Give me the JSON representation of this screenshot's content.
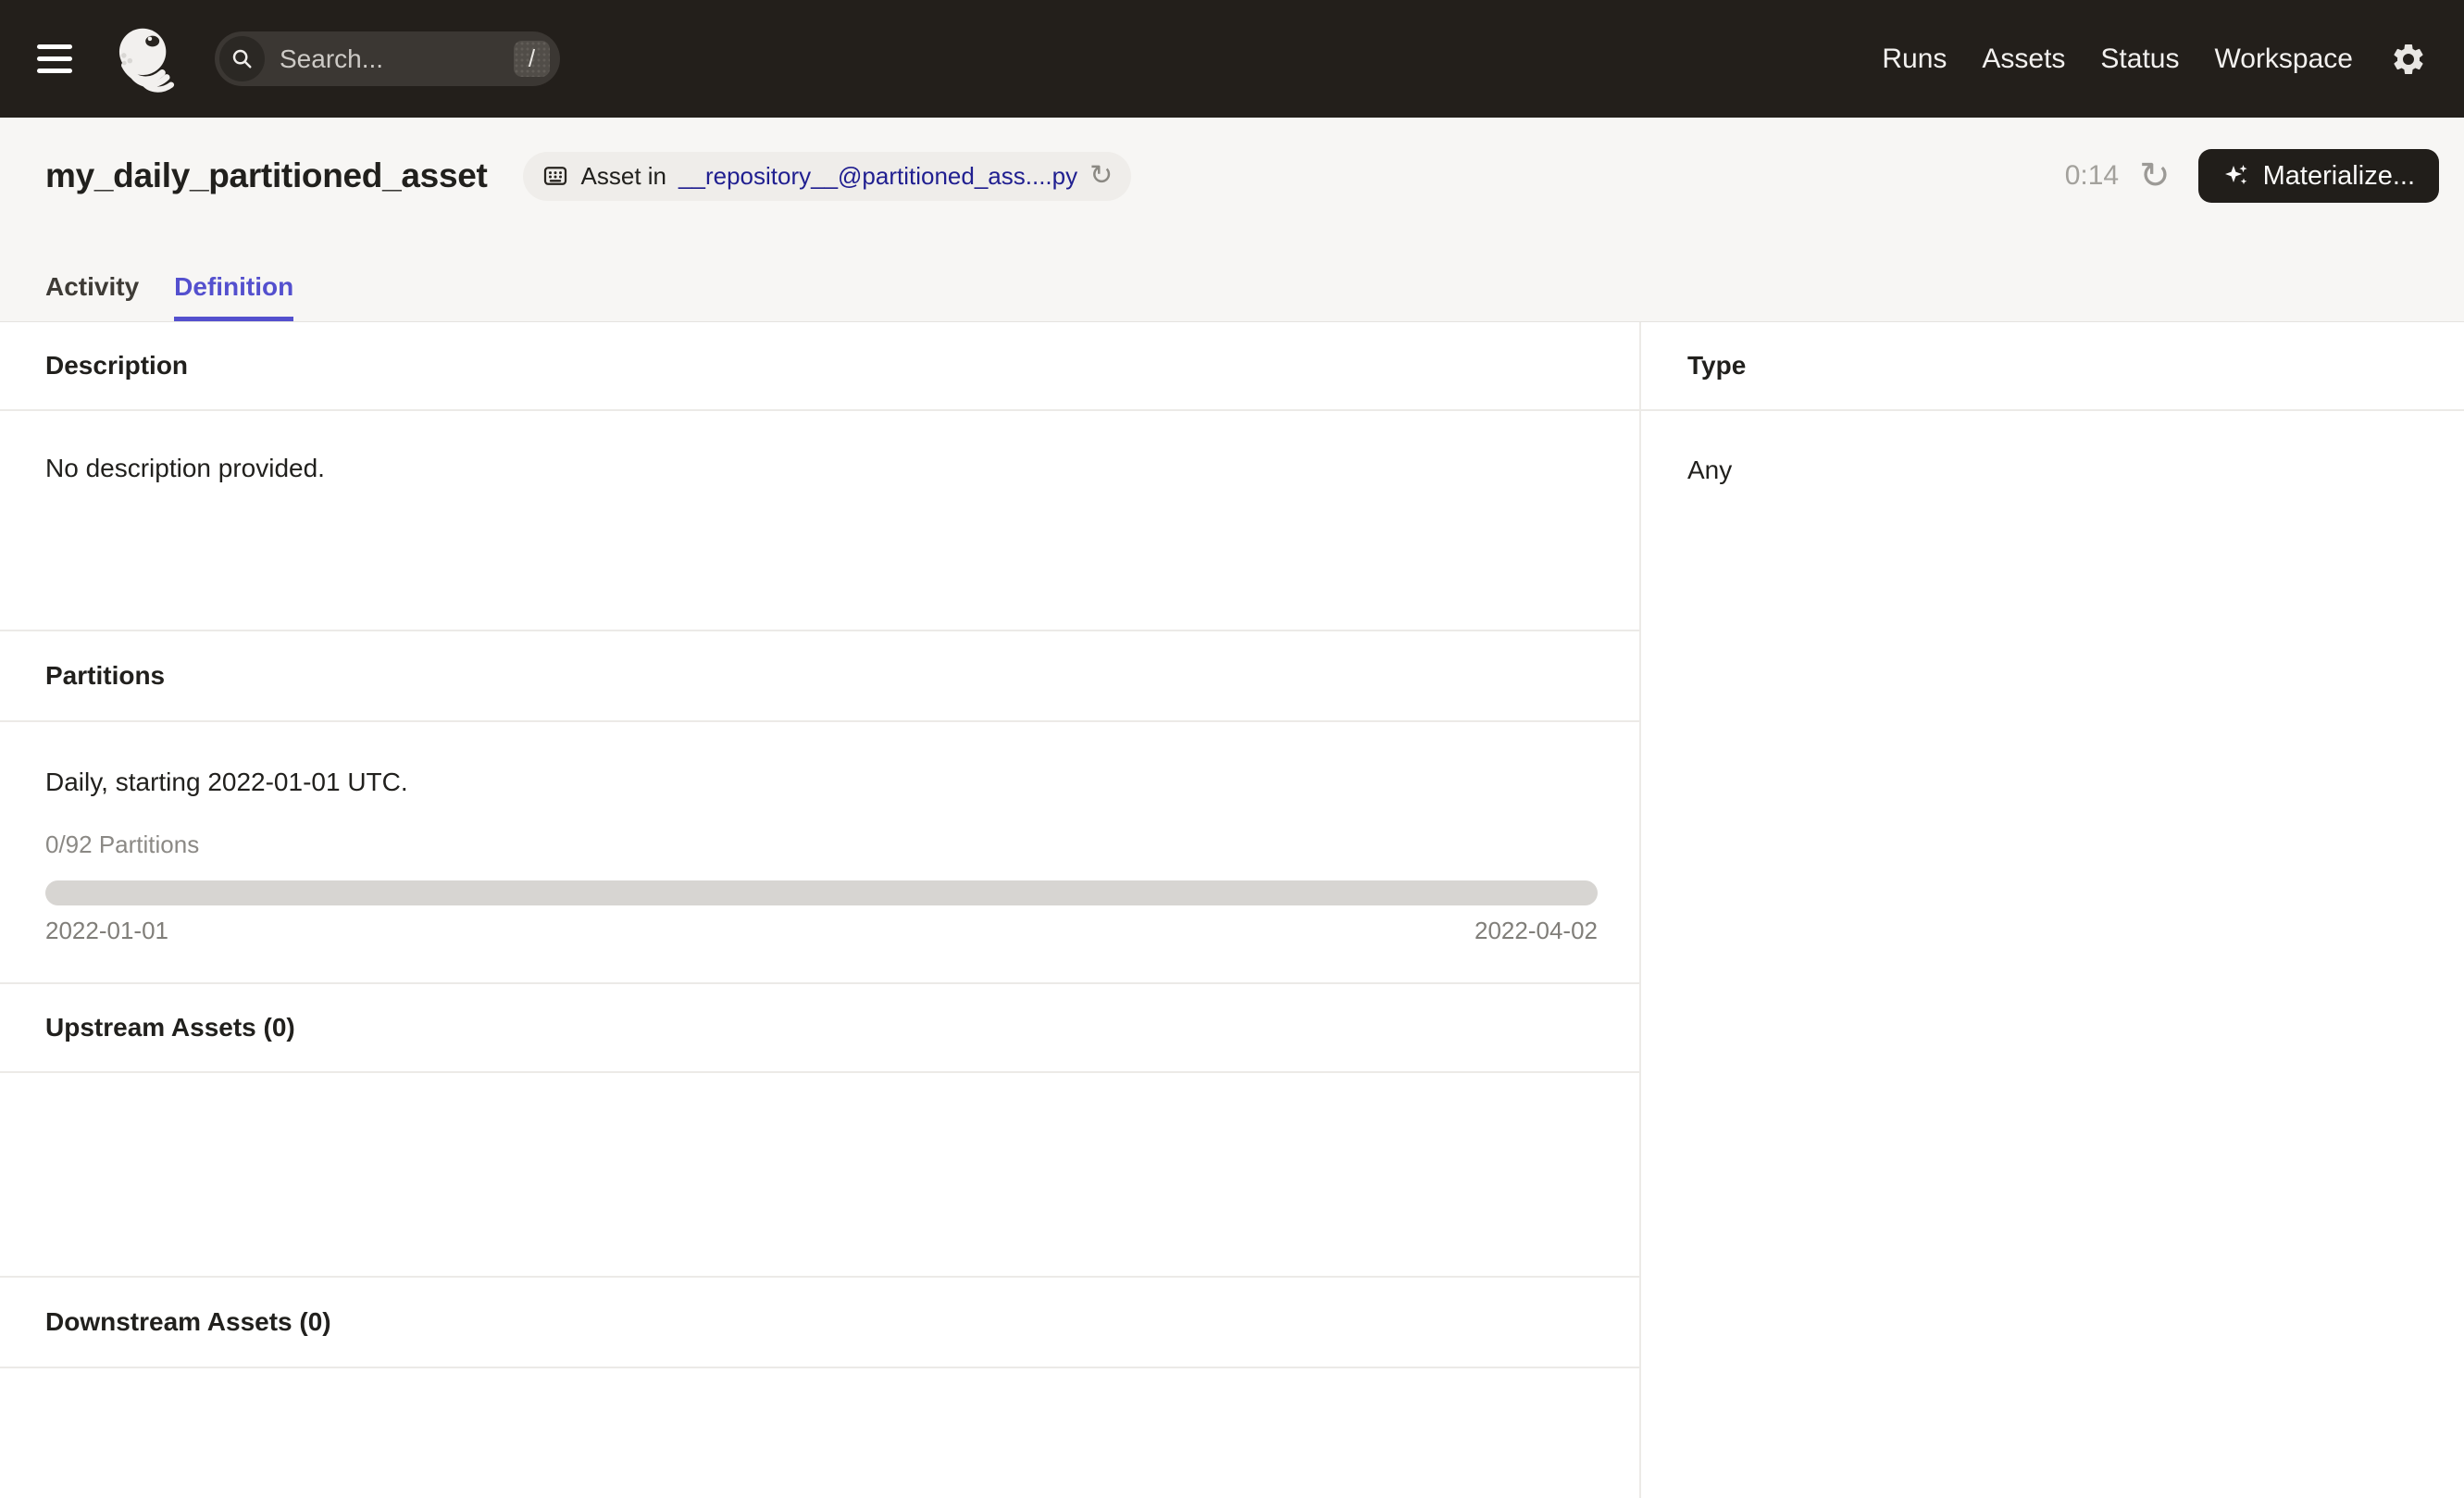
{
  "nav": {
    "search_placeholder": "Search...",
    "shortcut_key": "/",
    "items": [
      "Runs",
      "Assets",
      "Status",
      "Workspace"
    ]
  },
  "header": {
    "title": "my_daily_partitioned_asset",
    "badge": {
      "prefix": "Asset in",
      "link": "__repository__@partitioned_ass....py"
    },
    "timer": "0:14",
    "materialize_label": "Materialize..."
  },
  "tabs": [
    {
      "label": "Activity",
      "active": false
    },
    {
      "label": "Definition",
      "active": true
    }
  ],
  "sections": {
    "description": {
      "title": "Description",
      "body": "No description provided."
    },
    "partitions": {
      "title": "Partitions",
      "body": "Daily, starting 2022-01-01 UTC.",
      "progress_label": "0/92 Partitions",
      "progress_percent": 0,
      "range_start": "2022-01-01",
      "range_end": "2022-04-02"
    },
    "upstream": {
      "title": "Upstream Assets (0)"
    },
    "downstream": {
      "title": "Downstream Assets (0)"
    },
    "type": {
      "title": "Type",
      "value": "Any"
    }
  },
  "colors": {
    "nav_background": "#231F1B",
    "accent_tab": "#5450CE",
    "badge_link": "#201F90",
    "progress_track": "#D7D5D2",
    "materialize_button": "#211E1A"
  }
}
